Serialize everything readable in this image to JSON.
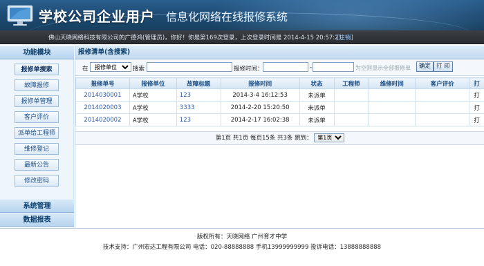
{
  "header": {
    "title_bold": "学校公司企业用户",
    "title_light": "信息化网络在线报修系统"
  },
  "infobar": {
    "message": "佛山天晓网络科技有限公司的广德鸿(管理员)，你好！你是第169次登录，上次登录时间是 2014-4-15 20:57:21",
    "logout": "[注销]"
  },
  "sidebar": {
    "heading": "功能模块",
    "items": [
      {
        "label": "报修单搜索",
        "active": true
      },
      {
        "label": "故障报修"
      },
      {
        "label": "报修单管理"
      },
      {
        "label": "客户评价"
      },
      {
        "label": "派单给工程师"
      },
      {
        "label": "维修登记"
      },
      {
        "label": "最新公告"
      },
      {
        "label": "修改密码"
      }
    ],
    "sections": [
      "系统管理",
      "数据报表"
    ]
  },
  "panel": {
    "title": "报修清单(含搜索)"
  },
  "search": {
    "in_label": "在",
    "field_selected": "报修单位",
    "search_label": "搜索",
    "search_value": "",
    "time_label": "报修时间：",
    "date_from": "",
    "dash": "-",
    "date_to": "",
    "hint": "为空则显示全部报修单",
    "confirm_label": "确定",
    "print_label": "打 印"
  },
  "table": {
    "headers": [
      "报修单号",
      "报修单位",
      "故障标题",
      "报修时间",
      "状态",
      "工程师",
      "维修时间",
      "客户评价",
      "打"
    ],
    "rows": [
      {
        "id": "2014030001",
        "unit": "A学校",
        "title": "123",
        "time": "2014-3-4 16:12:53",
        "status": "未派单",
        "engineer": "",
        "repair_time": "",
        "rating": "",
        "print": "打"
      },
      {
        "id": "2014020003",
        "unit": "A学校",
        "title": "3333",
        "time": "2014-2-20 15:20:50",
        "status": "未派单",
        "engineer": "",
        "repair_time": "",
        "rating": "",
        "print": "打"
      },
      {
        "id": "2014020002",
        "unit": "A学校",
        "title": "123",
        "time": "2014-2-17 16:02:38",
        "status": "未派单",
        "engineer": "",
        "repair_time": "",
        "rating": "",
        "print": "打"
      }
    ]
  },
  "pager": {
    "text": "第1页 共1页 每页15条 共3条 跳到：",
    "page_selected": "第1页"
  },
  "footer": {
    "copyright": "版权所有：天晓网络 广州育才中学",
    "support": "技术支持：广州宏达工程有限公司 电话：020-88888888 手机13999999999 投诉电话：13888888888"
  },
  "colors": {
    "header_bg": "#1f4c76",
    "infobar_bg": "#2f3337",
    "link": "#2a5aa8",
    "heading_text": "#0a3d6b"
  }
}
